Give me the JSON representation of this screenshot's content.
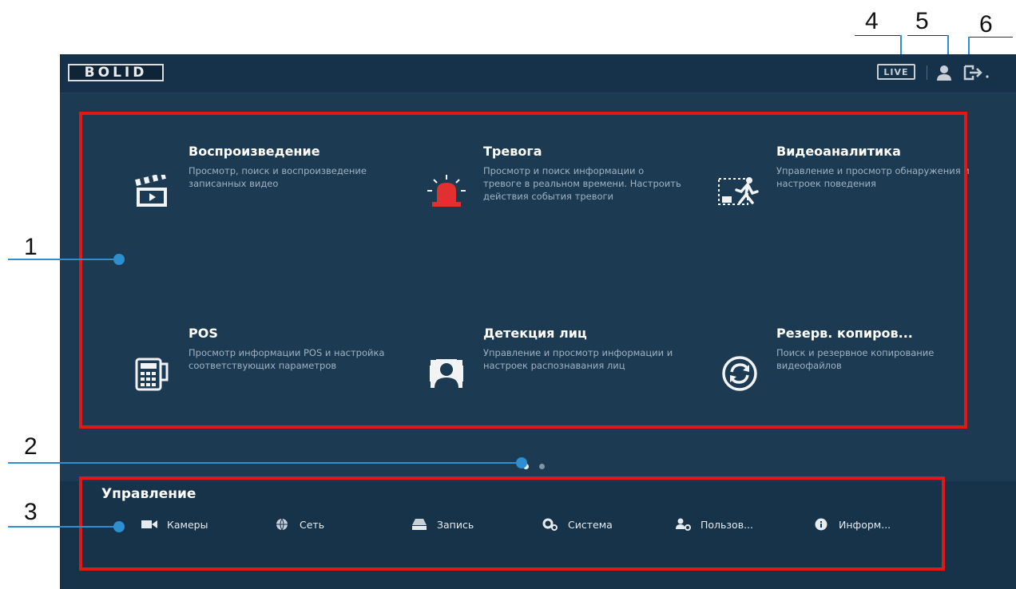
{
  "callouts": [
    "1",
    "2",
    "3",
    "4",
    "5",
    "6"
  ],
  "header": {
    "logo_text": "BOLID",
    "live_label": "LIVE"
  },
  "tiles": [
    {
      "title": "Воспроизведение",
      "desc": "Просмотр, поиск и воспроизведение записанных видео",
      "icon": "clapperboard-icon"
    },
    {
      "title": "Тревога",
      "desc": "Просмотр и поиск информации о тревоге в реальном времени. Настроить действия события тревоги",
      "icon": "alarm-siren-icon"
    },
    {
      "title": "Видеоаналитика",
      "desc": "Управление и просмотр обнаружения и настроек поведения",
      "icon": "video-analytics-icon"
    },
    {
      "title": "POS",
      "desc": "Просмотр информации POS и настройка соответствующих параметров",
      "icon": "pos-terminal-icon"
    },
    {
      "title": "Детекция лиц",
      "desc": "Управление и просмотр информации и настроек распознавания лиц",
      "icon": "face-detection-icon"
    },
    {
      "title": "Резерв. копиров...",
      "desc": "Поиск и резервное копирование видеофайлов",
      "icon": "backup-sync-icon"
    }
  ],
  "pager": {
    "pages": 2,
    "current": 1
  },
  "management": {
    "title": "Управление",
    "items": [
      {
        "label": "Камеры",
        "icon": "camera-icon"
      },
      {
        "label": "Сеть",
        "icon": "network-globe-icon"
      },
      {
        "label": "Запись",
        "icon": "recording-hdd-icon"
      },
      {
        "label": "Система",
        "icon": "system-gears-icon"
      },
      {
        "label": "Пользов...",
        "icon": "user-settings-icon"
      },
      {
        "label": "Информ...",
        "icon": "info-icon"
      }
    ]
  },
  "colors": {
    "screen_bg": "#1c3a52",
    "highlight_red": "#e01818",
    "callout_blue": "#2d8fd0"
  }
}
